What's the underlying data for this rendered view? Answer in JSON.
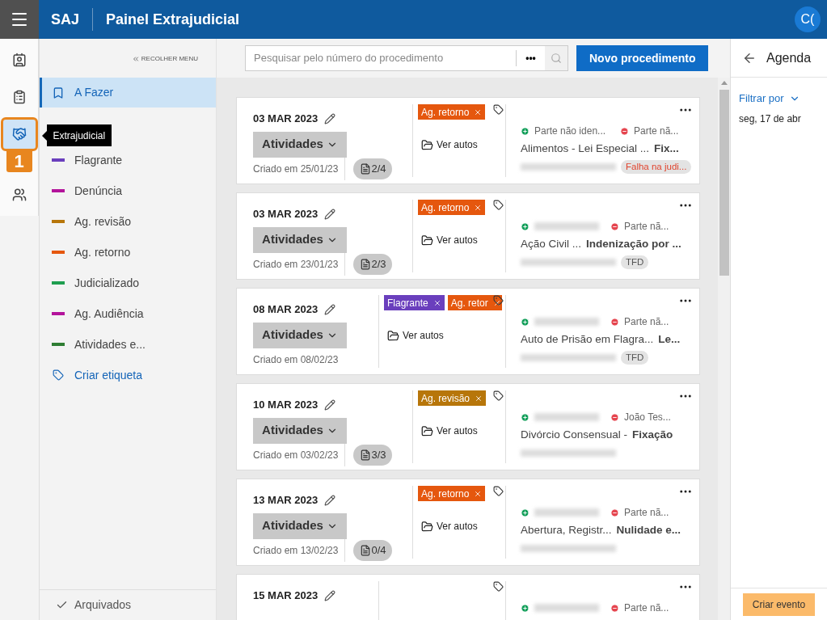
{
  "header": {
    "app": "SAJ",
    "title": "Painel Extrajudicial",
    "avatar": "C("
  },
  "rail": {
    "items": [
      {
        "selected": false
      },
      {
        "selected": false
      },
      {
        "selected": true
      },
      {
        "selected": false
      }
    ],
    "tooltip": "Extrajudicial",
    "callout": "1"
  },
  "sidebar": {
    "collapse": "RECOLHER MENU",
    "items": [
      {
        "kind": "view",
        "label": "A Fazer",
        "selected": true
      },
      {
        "kind": "tag",
        "label": "Flagrante",
        "color": "#6a3fbd",
        "selected": false
      },
      {
        "kind": "tag",
        "label": "Denúncia",
        "color": "#b3139b",
        "selected": false
      },
      {
        "kind": "tag",
        "label": "Ag. revisão",
        "color": "#b7760a",
        "selected": false
      },
      {
        "kind": "tag",
        "label": "Ag. retorno",
        "color": "#e5570e",
        "selected": false
      },
      {
        "kind": "tag",
        "label": "Judicializado",
        "color": "#1f9e4f",
        "selected": false
      },
      {
        "kind": "tag",
        "label": "Ag. Audiência",
        "color": "#b3139b",
        "selected": false
      },
      {
        "kind": "tag",
        "label": "Atividades e...",
        "color": "#2e7d32",
        "selected": false
      },
      {
        "kind": "action",
        "label": "Criar etiqueta",
        "selected": false
      }
    ],
    "footer": "Arquivados"
  },
  "search": {
    "placeholder": "Pesquisar pelo número do procedimento",
    "more": "•••",
    "new_button": "Novo procedimento"
  },
  "cards": [
    {
      "date": "03 MAR 2023",
      "activities": "Atividades",
      "created": "Criado em 25/01/23",
      "docs": "2/4",
      "tags": [
        {
          "label": "Ag. retorno",
          "color": "#e5570e"
        }
      ],
      "files": "Ver autos",
      "party_plus": "Parte não iden...",
      "party_minus": "Parte nã...",
      "class": "Alimentos - Lei Especial ...",
      "subject": "Fix...",
      "chip": {
        "label": "Falha na judi...",
        "kind": "alert"
      }
    },
    {
      "date": "03 MAR 2023",
      "activities": "Atividades",
      "created": "Criado em 23/01/23",
      "docs": "2/3",
      "tags": [
        {
          "label": "Ag. retorno",
          "color": "#e5570e"
        }
      ],
      "files": "Ver autos",
      "party_minus": "Parte nã...",
      "class": "Ação Civil ...",
      "subject": "Indenização por ...",
      "chip": {
        "label": "TFD",
        "kind": "neutral"
      }
    },
    {
      "date": "08 MAR 2023",
      "activities": "Atividades",
      "created": "Criado em 08/02/23",
      "tags": [
        {
          "label": "Flagrante",
          "color": "#6a3fbd"
        },
        {
          "label": "Ag. retor",
          "color": "#e5570e"
        }
      ],
      "files": "Ver autos",
      "party_minus": "Parte nã...",
      "class": "Auto de Prisão em Flagra...",
      "subject": "Le...",
      "chip": {
        "label": "TFD",
        "kind": "neutral"
      }
    },
    {
      "date": "10 MAR 2023",
      "activities": "Atividades",
      "created": "Criado em 03/02/23",
      "docs": "3/3",
      "tags": [
        {
          "label": "Ag. revisão",
          "color": "#b7760a"
        }
      ],
      "files": "Ver autos",
      "party_minus": "João Tes...",
      "class": "Divórcio Consensual -",
      "subject": "Fixação"
    },
    {
      "date": "13 MAR 2023",
      "activities": "Atividades",
      "created": "Criado em 13/02/23",
      "docs": "0/4",
      "tags": [
        {
          "label": "Ag. retorno",
          "color": "#e5570e"
        }
      ],
      "files": "Ver autos",
      "party_minus": "Parte nã...",
      "class": "Abertura, Registr...",
      "subject": "Nulidade e..."
    },
    {
      "date": "15 MAR 2023",
      "party_minus": "Parte nã..."
    }
  ],
  "agenda": {
    "title": "Agenda",
    "filter": "Filtrar por",
    "date": "seg, 17 de abr",
    "button": "Criar evento"
  }
}
